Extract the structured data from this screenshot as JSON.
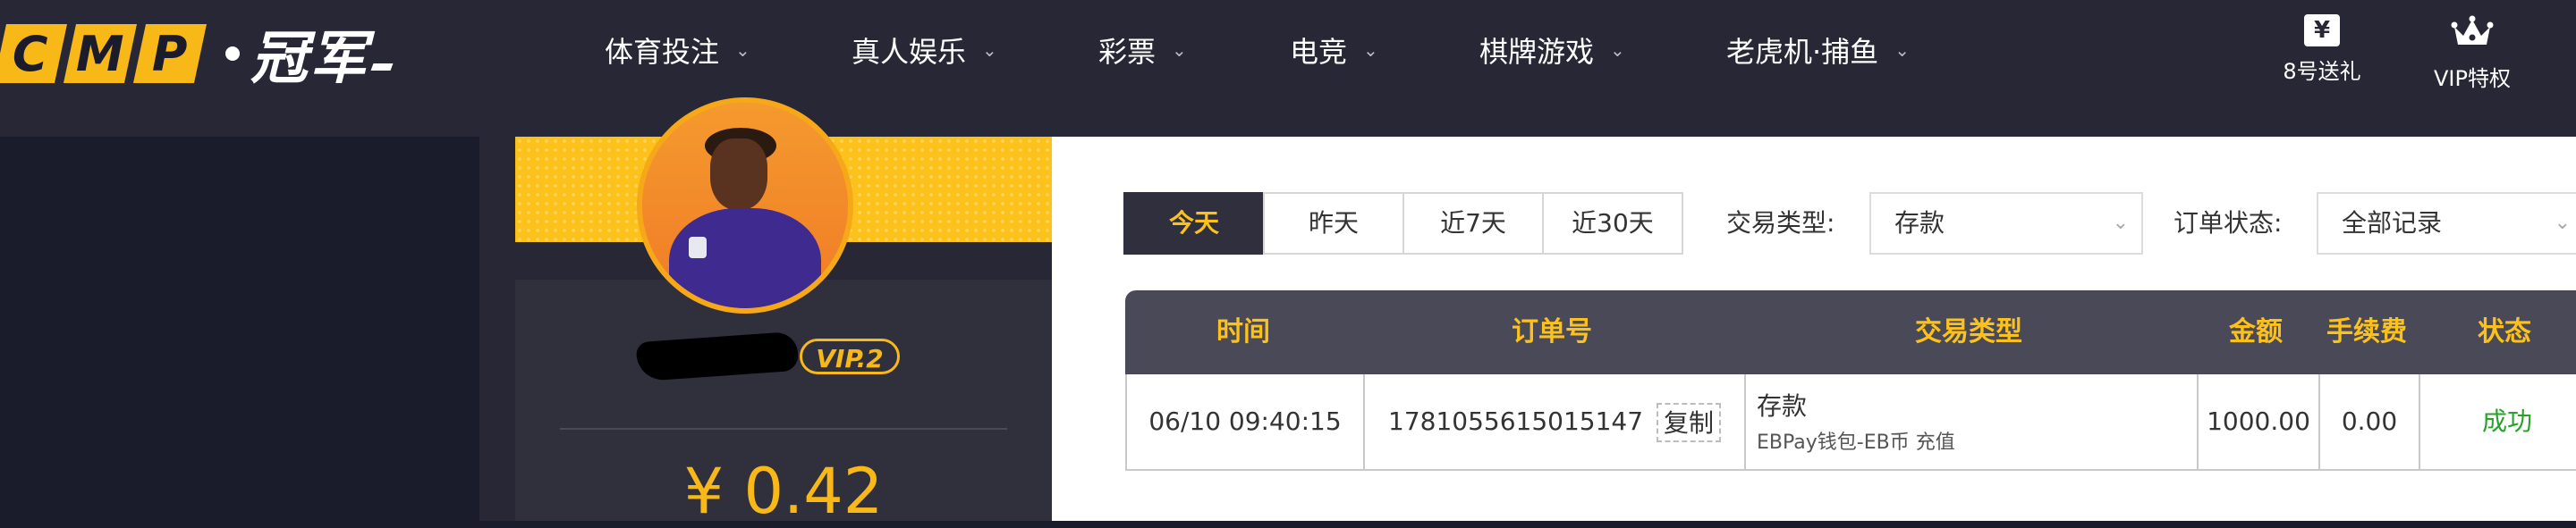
{
  "header": {
    "logo_letters": [
      "C",
      "M",
      "P"
    ],
    "logo_text": "冠军",
    "nav": [
      {
        "label": "体育投注",
        "icon": "chevron-down-icon"
      },
      {
        "label": "真人娱乐",
        "icon": "chevron-down-icon"
      },
      {
        "label": "彩票",
        "icon": "chevron-down-icon"
      },
      {
        "label": "电竞",
        "icon": "chevron-down-icon"
      },
      {
        "label": "棋牌游戏",
        "icon": "chevron-down-icon"
      },
      {
        "label": "老虎机·捕鱼",
        "icon": "chevron-down-icon"
      }
    ],
    "actions": [
      {
        "label": "8号送礼",
        "icon": "yen-gift-icon",
        "glyph": "¥"
      },
      {
        "label": "VIP特权",
        "icon": "crown-icon"
      }
    ]
  },
  "profile": {
    "vip_level": "VIP.2",
    "balance": "¥ 0.42"
  },
  "filters": {
    "date_tabs": [
      "今天",
      "昨天",
      "近7天",
      "近30天"
    ],
    "active_date_tab": "今天",
    "type_label": "交易类型:",
    "type_value": "存款",
    "status_label": "订单状态:",
    "status_value": "全部记录"
  },
  "table": {
    "columns": [
      "时间",
      "订单号",
      "交易类型",
      "金额",
      "手续费",
      "状态"
    ],
    "rows": [
      {
        "time": "06/10 09:40:15",
        "order_no": "1781055615015147",
        "copy_label": "复制",
        "type": "存款",
        "type_detail": "EBPay钱包-EB币 充值",
        "amount": "1000.00",
        "fee": "0.00",
        "status": "成功"
      }
    ]
  },
  "colors": {
    "topbar": "#272735",
    "accent": "#fcc21b",
    "success": "#2aa22a",
    "table_header": "#4a4958"
  }
}
